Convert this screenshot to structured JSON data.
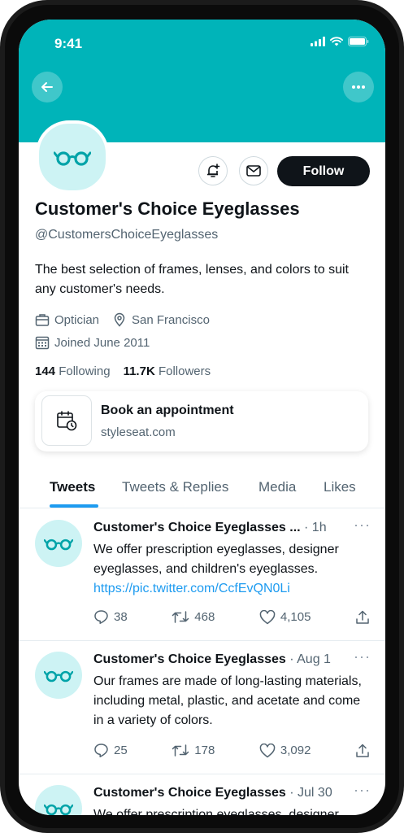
{
  "status_bar": {
    "time": "9:41"
  },
  "profile": {
    "name": "Customer's Choice Eyeglasses",
    "handle": "@CustomersChoiceEyeglasses",
    "bio": "The best selection of frames, lenses, and colors to suit any customer's needs.",
    "category": "Optician",
    "location": "San Francisco",
    "joined": "Joined June 2011",
    "following_count": "144",
    "following_label": "Following",
    "followers_count": "11.7K",
    "followers_label": "Followers",
    "follow_label": "Follow"
  },
  "card": {
    "title": "Book an appointment",
    "subtitle": "styleseat.com"
  },
  "tabs": [
    {
      "label": "Tweets",
      "active": true
    },
    {
      "label": "Tweets & Replies"
    },
    {
      "label": "Media"
    },
    {
      "label": "Likes"
    }
  ],
  "tweets": [
    {
      "name": "Customer's Choice Eyeglasses ...",
      "time": " · 1h",
      "text": "We offer prescription eyeglasses, designer eyeglasses, and children's eyeglasses.",
      "link": "https://pic.twitter.com/CcfEvQN0Li",
      "replies": "38",
      "retweets": "468",
      "likes": "4,105"
    },
    {
      "name": "Customer's Choice Eyeglasses",
      "time": " · Aug 1",
      "text": "Our frames are made of long-lasting materials, including metal, plastic, and acetate and come in a variety of colors.",
      "replies": "25",
      "retweets": "178",
      "likes": "3,092"
    },
    {
      "name": "Customer's Choice Eyeglasses",
      "time": " · Jul 30",
      "text": "We offer prescription eyeglasses, designer eyeglasses, and children's eyeglasses."
    }
  ],
  "colors": {
    "banner": "#00B4B9",
    "accent": "#1d9bf0",
    "avatar_bg": "#cdf3f4",
    "glasses": "#00a3a8"
  },
  "icons": {
    "back": "arrow-left-icon",
    "more": "more-icon",
    "bell": "bell-plus-icon",
    "mail": "mail-icon",
    "calendar": "calendar-clock-icon",
    "avatar": "eyeglasses-icon"
  }
}
